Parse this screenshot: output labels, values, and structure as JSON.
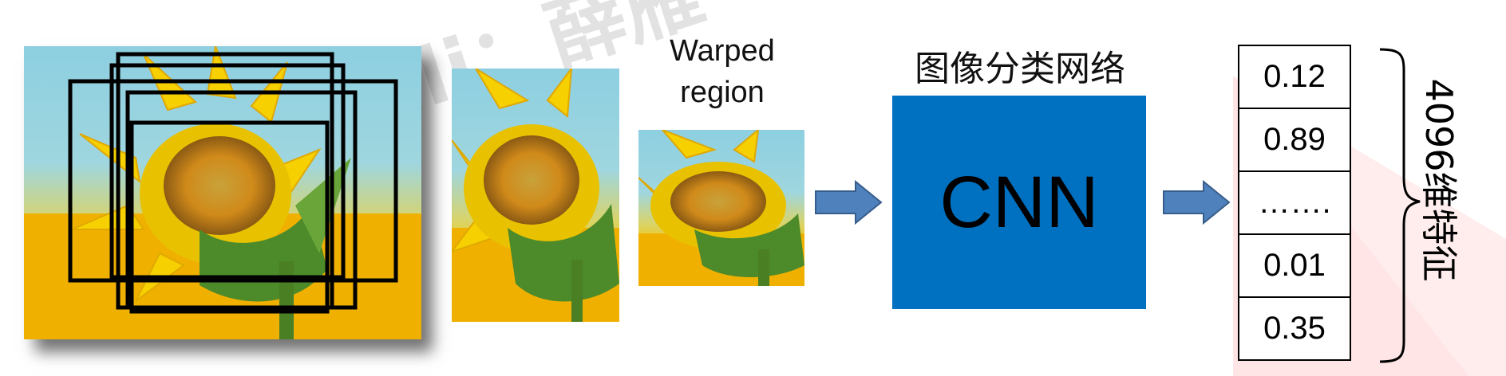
{
  "watermark": "bilibili：薛雁",
  "warped_label": [
    "Warped",
    "region"
  ],
  "network_label": "图像分类网络",
  "cnn_label": "CNN",
  "feature_values": [
    "0.12",
    "0.89",
    "…….",
    "0.01",
    "0.35"
  ],
  "dimension_label": "4096维特征",
  "colors": {
    "cnn_box": "#0070c0",
    "arrow": "#4f81bd",
    "triangle": "#ffe0e0"
  }
}
